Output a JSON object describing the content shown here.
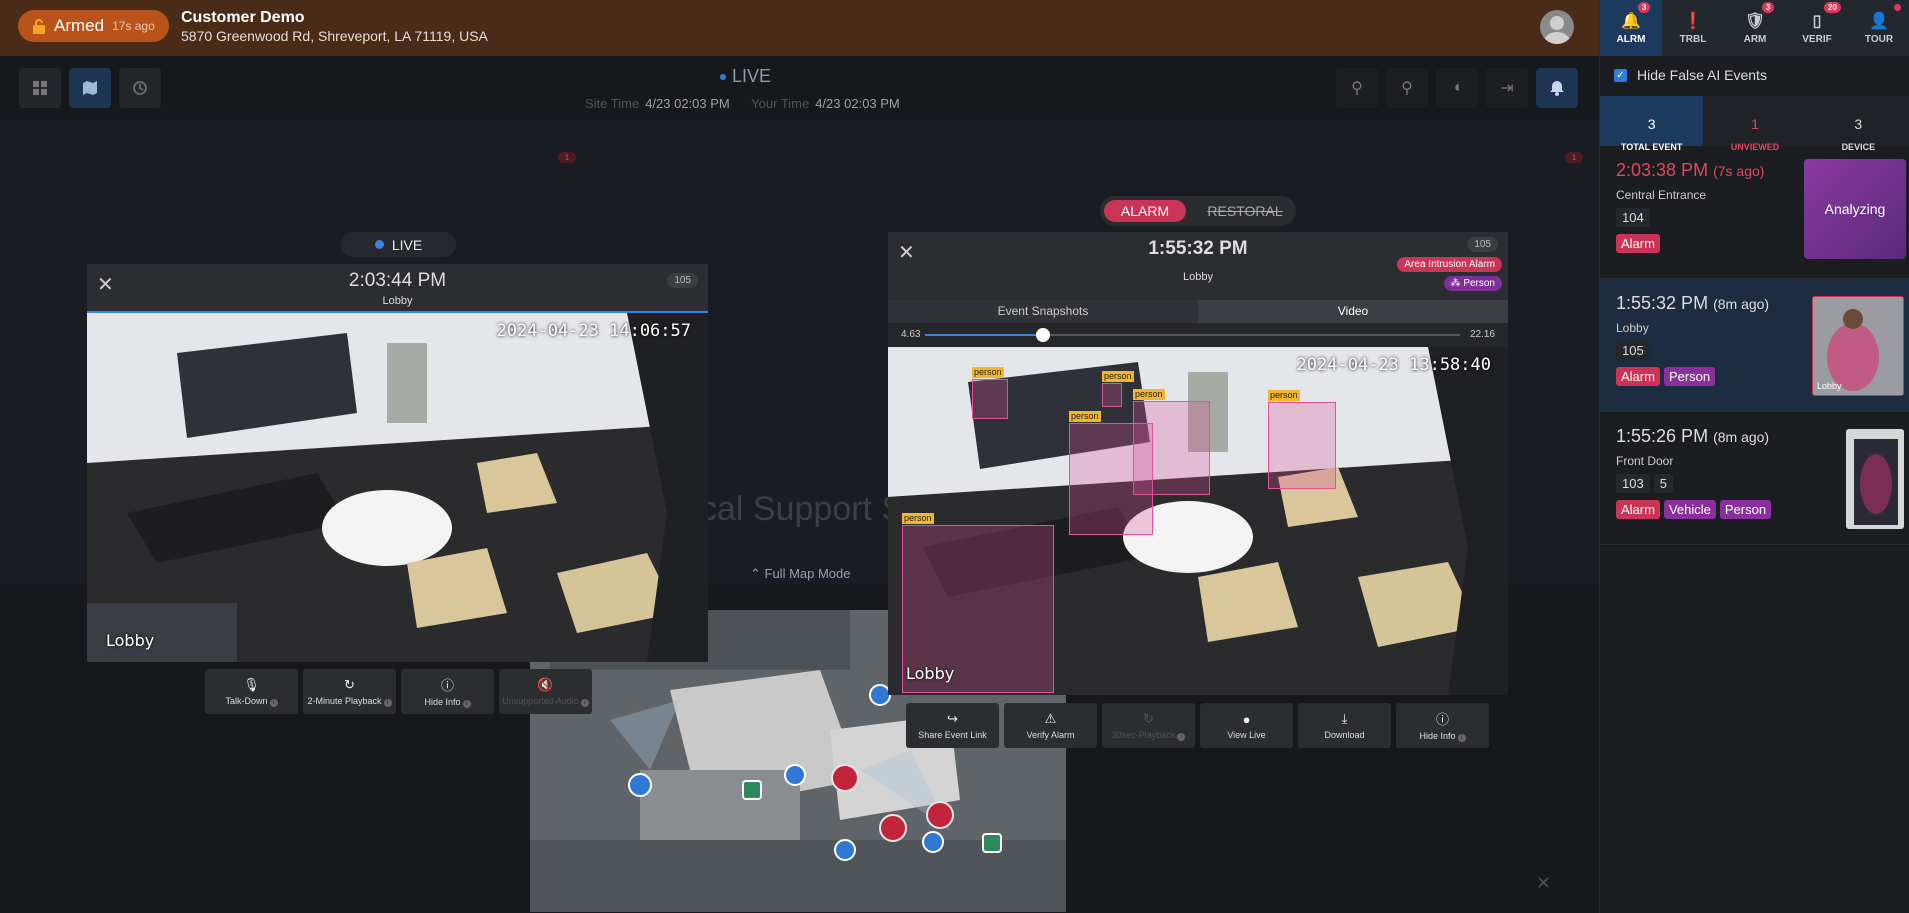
{
  "header": {
    "armed_label": "Armed",
    "armed_ago": "17s ago",
    "customer_name": "Customer Demo",
    "customer_address": "5870 Greenwood Rd, Shreveport, LA 71119, USA"
  },
  "toolbar": {
    "live_label": "LIVE",
    "site_time_label": "Site Time",
    "site_time_value": "4/23 02:03 PM",
    "your_time_label": "Your Time",
    "your_time_value": "4/23 02:03 PM"
  },
  "map": {
    "background_text": "cal Support S",
    "full_map_label": "Full Map Mode",
    "marker_badge_left": "1",
    "marker_badge_right": "1"
  },
  "live_pane": {
    "chip_label": "LIVE",
    "time": "2:03:44 PM",
    "location": "Lobby",
    "camera_id": "105",
    "overlay_timestamp": "2024-04-23 14:06:57",
    "overlay_name": "Lobby",
    "controls": [
      "Talk-Down",
      "2-Minute Playback",
      "Hide Info",
      "Unsupported Audio"
    ]
  },
  "event_pane": {
    "toggle_alarm": "ALARM",
    "toggle_restoral": "RESTORAL",
    "time": "1:55:32 PM",
    "location": "Lobby",
    "camera_id": "105",
    "tag_alarm": "Area Intrusion Alarm",
    "tag_person": "Person",
    "tab_snapshots": "Event Snapshots",
    "tab_video": "Video",
    "scrub_start": "4.63",
    "scrub_end": "22.16",
    "scrub_progress": 0.22,
    "overlay_timestamp": "2024-04-23 13:58:40",
    "overlay_name": "Lobby",
    "detection_label": "person",
    "controls": [
      "Share Event Link",
      "Verify Alarm",
      "30sec-Playback",
      "View Live",
      "Download",
      "Hide Info"
    ]
  },
  "right_panel": {
    "tabs": [
      {
        "label": "ALRM",
        "badge": "3"
      },
      {
        "label": "TRBL",
        "badge": ""
      },
      {
        "label": "ARM",
        "badge": "3"
      },
      {
        "label": "VERIF",
        "badge": "20"
      },
      {
        "label": "TOUR",
        "badge": ""
      }
    ],
    "hide_false_label": "Hide False AI Events",
    "summary": [
      {
        "count": "3",
        "label": "TOTAL EVENT"
      },
      {
        "count": "1",
        "label": "UNVIEWED"
      },
      {
        "count": "3",
        "label": "DEVICE"
      }
    ],
    "events": [
      {
        "time": "2:03:38 PM",
        "ago": "(7s ago)",
        "location": "Central Entrance",
        "ids": [
          "104"
        ],
        "tags": [
          "Alarm"
        ],
        "status": "Analyzing"
      },
      {
        "time": "1:55:32 PM",
        "ago": "(8m ago)",
        "location": "Lobby",
        "ids": [
          "105"
        ],
        "tags": [
          "Alarm",
          "Person"
        ],
        "thumb_label": "Lobby"
      },
      {
        "time": "1:55:26 PM",
        "ago": "(8m ago)",
        "location": "Front Door",
        "ids": [
          "103",
          "5"
        ],
        "tags": [
          "Alarm",
          "Vehicle",
          "Person"
        ]
      }
    ]
  },
  "colors": {
    "header_bg": "#4a2b18",
    "armed_pill": "#b9531a",
    "alarm_red": "#c93457",
    "person_purple": "#8c2f9e",
    "active_blue": "#1c3a5e"
  }
}
